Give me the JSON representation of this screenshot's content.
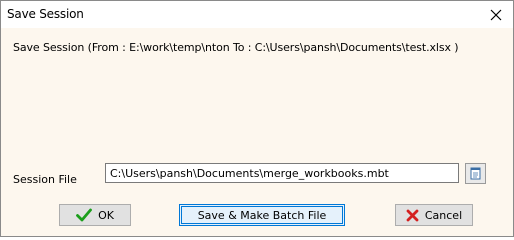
{
  "window": {
    "title": "Save Session"
  },
  "content": {
    "info_line": "Save Session (From : E:\\work\\temp\\nton  To : C:\\Users\\pansh\\Documents\\test.xlsx  )"
  },
  "session_file": {
    "label": "Session File",
    "value": "C:\\Users\\pansh\\Documents\\merge_workbooks.mbt"
  },
  "buttons": {
    "ok_label": "OK",
    "batch_label": "Save & Make Batch File",
    "cancel_label": "Cancel"
  },
  "icons": {
    "close": "close-icon",
    "browse": "browse-file-icon",
    "ok": "checkmark-icon",
    "cancel": "red-x-icon"
  },
  "colors": {
    "dialog_background": "#fdf7ee",
    "checkmark_green": "#1b9e1b",
    "cancel_red": "#d42020",
    "focus_blue": "#0078d7"
  }
}
